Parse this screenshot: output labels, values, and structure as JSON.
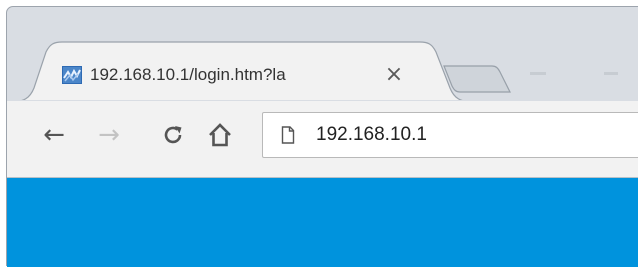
{
  "tab": {
    "title": "192.168.10.1/login.htm?la",
    "close_glyph": "×",
    "favicon": "router-favicon-icon"
  },
  "toolbar": {
    "back_glyph": "←",
    "forward_glyph": "→",
    "reload_icon": "reload-icon",
    "home_icon": "home-icon"
  },
  "omnibox": {
    "url": "192.168.10.1",
    "page_icon": "page-icon"
  },
  "colors": {
    "page_background": "#0093dd",
    "toolbar": "#f2f2f2",
    "tabstrip": "#d9dde3"
  }
}
